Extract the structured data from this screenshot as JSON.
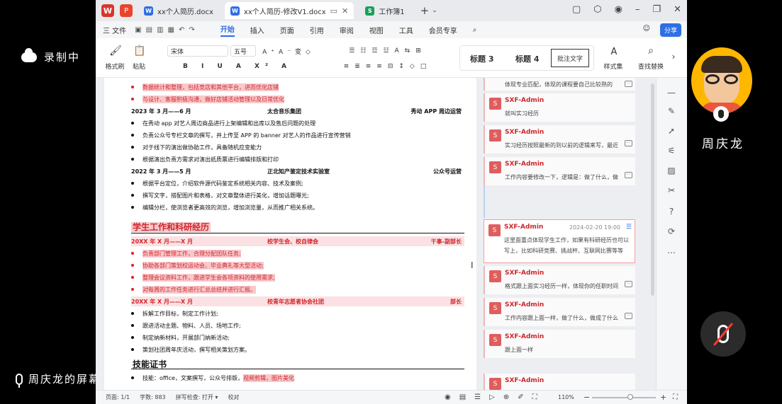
{
  "overlay": {
    "recording": "录制中",
    "share_text": "周庆龙的屏幕共享",
    "user_name": "周庆龙"
  },
  "tabs": [
    {
      "label": "xx个人简历.docx",
      "icon": "W"
    },
    {
      "label": "xx个人简历-修改V1.docx",
      "icon": "W"
    },
    {
      "label": "工作簿1",
      "icon": "S"
    }
  ],
  "menu": {
    "file": "三 文件",
    "items": [
      "开始",
      "插入",
      "页面",
      "引用",
      "审阅",
      "视图",
      "工具",
      "会员专享"
    ],
    "share": "分享"
  },
  "ribbon": {
    "format_painter": "格式刷",
    "paste": "粘贴",
    "font": "宋体",
    "size": "五号",
    "styles": [
      "标题 3",
      "标题 4",
      "批注文字"
    ],
    "style_set": "样式集",
    "find_replace": "查找替换"
  },
  "document": {
    "lines_top": [
      "数据统计和整理，包括竞店和其他平台，进而优化店铺",
      "与设计、客服积极沟通，做好店铺活动管理以及日常优化"
    ],
    "job1": {
      "date": "2023 年 3 月——6 月",
      "org": "太合音乐集团",
      "role": "秀动 APP 周边运营"
    },
    "job1_items": [
      "在秀动 app 对艺人周边商品进行上架编辑和出库以及售后问题的处理",
      "负责公众号专栏文章的撰写，并上传至 APP 的 banner 对艺人的作品进行宣传营销",
      "对于线下的演出做协助工作，具备随机应变能力",
      "根据演出负责方需求对演出纸质票进行编辑排版和打印"
    ],
    "job2": {
      "date": "2022 年 3 月——5 月",
      "org": "正北知产鉴定技术实验室",
      "role": "公众号运营"
    },
    "job2_items": [
      "根据平台定位，介绍软件源代码鉴定系统相关内容、技术及案例;",
      "撰写文字，搭配图片和表格，对文章整体进行美化，增加话题曝光;",
      "编辑分栏，使浏览者更高效的浏览，增加浏览量，从而推广相关系统。"
    ],
    "section1": "学生工作和科研经历",
    "job3": {
      "date": "20XX 年 X 月——X 月",
      "org": "校学生会、校自律会",
      "role": "干事-副部长"
    },
    "job3_items": [
      "负责部门管理工作，合理分配团队任务;",
      "协助各部门策划校运动会、毕业典礼等大型活动;",
      "整理会议资料工作，跟进学生会各项资料的使用需求;",
      "对每周的工作任务进行汇总总结并进行汇报。"
    ],
    "job4": {
      "date": "20XX 年 X 月——X 月",
      "org": "校青年志愿者协会社团",
      "role": "部长"
    },
    "job4_items": [
      "拆解工作目标，制定工作计划;",
      "跟进活动主题、物料、人员、场地工作;",
      "制定纳新材料，开展部门纳新活动;",
      "策划社团周年庆活动，撰写相关策划方案。"
    ],
    "section2": "技能证书",
    "skills_prefix": "技能：office，文案撰写，公众号排版，",
    "skills_hl": "视频剪辑，图片美化"
  },
  "comments": [
    {
      "author": "",
      "text": "体现专业匹配，体现的课程要自己比较熟的"
    },
    {
      "author": "SXF-Admin",
      "text": "就叫实习经历"
    },
    {
      "author": "SXF-Admin",
      "text": "实习经历按照最新的到以前的逻辑来写，最近"
    },
    {
      "author": "SXF-Admin",
      "text": "工作内容要修改一下，逻辑是：做了什么，做"
    },
    {
      "author": "SXF-Admin",
      "date": "2024-02-20 19:00",
      "text": "这里面重点体现学生工作，如果有科研经历也可以写上，比如科研竞赛、挑战杯、互联网比赛等等"
    },
    {
      "author": "SXF-Admin",
      "text": "格式跟上面实习经历一样，体现你的任职时间"
    },
    {
      "author": "SXF-Admin",
      "text": "工作内容跟上面一样，做了什么，做成了什么"
    },
    {
      "author": "SXF-Admin",
      "text": "跟上面一样"
    },
    {
      "author": "SXF-Admin",
      "text": ""
    }
  ],
  "status": {
    "page": "页面: 1/1",
    "words": "字数: 883",
    "spell": "拼写检查: 打开 ▾",
    "proof": "校对",
    "zoom": "110%"
  }
}
